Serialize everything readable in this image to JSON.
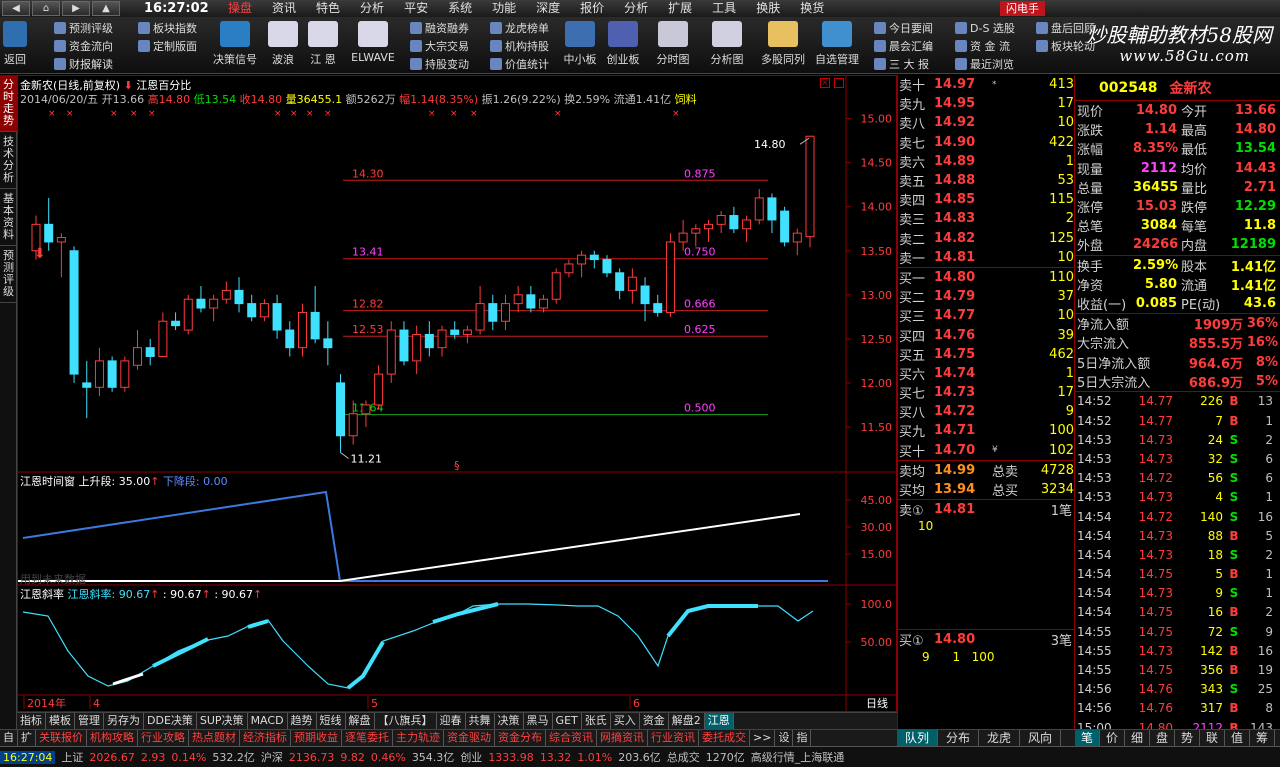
{
  "menubar": {
    "time": "16:27:02",
    "items": [
      "操盘",
      "资讯",
      "特色",
      "分析",
      "平安",
      "系统",
      "功能",
      "深度",
      "报价",
      "分析",
      "扩展",
      "工具",
      "换肤",
      "换货"
    ],
    "active_index": 0,
    "flash_label": "闪电手"
  },
  "toolbar": {
    "back": "返回",
    "small_col1": [
      "预测评级",
      "资金流向",
      "财报解读"
    ],
    "small_col2": [
      "板块指数",
      "定制版面"
    ],
    "big": [
      "决策信号",
      "波浪",
      "江 恩",
      "ELWAVE"
    ],
    "small_col3": [
      "融资融券",
      "大宗交易",
      "持股变动"
    ],
    "small_col4": [
      "龙虎榜单",
      "机构持股",
      "价值统计"
    ],
    "big2": [
      "中小板",
      "创业板",
      "分时图",
      "分析图",
      "多股同列",
      "自选管理"
    ],
    "small_col5": [
      "今日要闻",
      "晨会汇编",
      "三 大 报"
    ],
    "small_col6": [
      "D-S 选股",
      "资 金 流",
      "最近浏览"
    ],
    "small_col7": [
      "盘后回顾",
      "板块轮动"
    ],
    "watermark": "炒股輔助教材58股网",
    "watermark_url": "www.58Gu.com"
  },
  "vtabs": [
    "分时走势",
    "技术分析",
    "基本资料",
    "预测评级"
  ],
  "chart": {
    "title": "金新农(日线,前复权)",
    "indicator_name": "江恩百分比",
    "info": {
      "date": "2014/06/20/五",
      "open": "开13.66",
      "high": "高14.80",
      "low": "低13.54",
      "close": "收14.80",
      "volume": "量36455.1",
      "amount": "额5262万",
      "change": "幅1.14(8.35%)",
      "swing": "振1.26(9.22%)",
      "turnover": "换2.59%",
      "float": "流通1.41亿",
      "sector": "饲料"
    },
    "price_axis": [
      "15.00",
      "14.50",
      "14.00",
      "13.50",
      "13.00",
      "12.50",
      "12.00",
      "11.50"
    ],
    "levels": [
      {
        "price": "14.30",
        "ratio": "0.875"
      },
      {
        "price": "13.41",
        "ratio": "0.750"
      },
      {
        "price": "12.82",
        "ratio": "0.666"
      },
      {
        "price": "12.53",
        "ratio": "0.625"
      },
      {
        "price": "11.64",
        "ratio": "0.500"
      }
    ],
    "high_label": "14.80",
    "low_label": "11.21",
    "sub1_title": "江恩时间窗",
    "sub1_up": "上升段: 35.00",
    "sub1_down": "下降段: 0.00",
    "sub1_axis": [
      "45.00",
      "30.00",
      "15.00"
    ],
    "sub1_note": "用到未来数据",
    "sub2_title": "江恩斜率",
    "sub2_name": "江恩斜率: 90.67",
    "sub2_v2": ": 90.67",
    "sub2_v3": ": 90.67",
    "sub2_axis": [
      "100.0",
      "50.00"
    ],
    "x_labels": [
      "2014年",
      "4",
      "5",
      "6"
    ],
    "period": "日线"
  },
  "chart_data": {
    "type": "candlestick",
    "title": "金新农(日线,前复权)",
    "ylim": [
      11.0,
      15.2
    ],
    "candles": [
      [
        13.5,
        13.9,
        13.4,
        13.8
      ],
      [
        13.8,
        14.1,
        13.5,
        13.6
      ],
      [
        13.6,
        13.7,
        13.2,
        13.65
      ],
      [
        13.5,
        13.55,
        12.0,
        12.1
      ],
      [
        12.0,
        12.25,
        11.6,
        11.95
      ],
      [
        11.95,
        12.4,
        11.85,
        12.25
      ],
      [
        12.25,
        12.3,
        11.9,
        11.95
      ],
      [
        11.95,
        12.3,
        11.9,
        12.25
      ],
      [
        12.2,
        12.6,
        12.15,
        12.4
      ],
      [
        12.4,
        12.5,
        12.2,
        12.3
      ],
      [
        12.3,
        12.8,
        12.3,
        12.7
      ],
      [
        12.7,
        12.8,
        12.6,
        12.65
      ],
      [
        12.6,
        13.0,
        12.55,
        12.95
      ],
      [
        12.95,
        13.1,
        12.8,
        12.85
      ],
      [
        12.85,
        13.0,
        12.7,
        12.95
      ],
      [
        12.95,
        13.15,
        12.9,
        13.05
      ],
      [
        13.05,
        13.2,
        12.8,
        12.9
      ],
      [
        12.9,
        13.0,
        12.7,
        12.75
      ],
      [
        12.75,
        12.95,
        12.7,
        12.9
      ],
      [
        12.9,
        13.0,
        12.5,
        12.6
      ],
      [
        12.6,
        12.7,
        12.3,
        12.4
      ],
      [
        12.4,
        12.9,
        12.3,
        12.8
      ],
      [
        12.8,
        13.1,
        12.45,
        12.5
      ],
      [
        12.5,
        12.7,
        12.2,
        12.4
      ],
      [
        12.0,
        12.1,
        11.21,
        11.4
      ],
      [
        11.4,
        11.8,
        11.3,
        11.65
      ],
      [
        11.65,
        11.8,
        11.5,
        11.75
      ],
      [
        11.75,
        12.2,
        11.7,
        12.1
      ],
      [
        12.1,
        12.7,
        12.0,
        12.6
      ],
      [
        12.6,
        12.7,
        12.2,
        12.25
      ],
      [
        12.25,
        12.65,
        12.1,
        12.55
      ],
      [
        12.55,
        12.7,
        12.3,
        12.4
      ],
      [
        12.4,
        12.65,
        12.3,
        12.6
      ],
      [
        12.6,
        12.7,
        12.5,
        12.55
      ],
      [
        12.55,
        12.65,
        12.45,
        12.6
      ],
      [
        12.6,
        13.1,
        12.55,
        12.9
      ],
      [
        12.9,
        13.0,
        12.6,
        12.7
      ],
      [
        12.7,
        13.0,
        12.6,
        12.9
      ],
      [
        12.9,
        13.1,
        12.8,
        13.0
      ],
      [
        13.0,
        13.1,
        12.8,
        12.85
      ],
      [
        12.85,
        13.0,
        12.8,
        12.95
      ],
      [
        12.95,
        13.3,
        12.9,
        13.25
      ],
      [
        13.25,
        13.4,
        13.2,
        13.35
      ],
      [
        13.35,
        13.5,
        13.2,
        13.45
      ],
      [
        13.45,
        13.5,
        13.3,
        13.4
      ],
      [
        13.4,
        13.45,
        13.2,
        13.25
      ],
      [
        13.25,
        13.3,
        12.95,
        13.05
      ],
      [
        13.05,
        13.3,
        12.9,
        13.2
      ],
      [
        13.1,
        13.2,
        12.7,
        12.9
      ],
      [
        12.9,
        13.0,
        12.75,
        12.8
      ],
      [
        12.8,
        13.7,
        12.75,
        13.6
      ],
      [
        13.6,
        13.85,
        13.5,
        13.7
      ],
      [
        13.7,
        13.8,
        13.55,
        13.75
      ],
      [
        13.75,
        13.85,
        13.6,
        13.8
      ],
      [
        13.8,
        13.95,
        13.7,
        13.9
      ],
      [
        13.9,
        14.0,
        13.7,
        13.75
      ],
      [
        13.75,
        13.9,
        13.6,
        13.85
      ],
      [
        13.85,
        14.2,
        13.8,
        14.1
      ],
      [
        14.1,
        14.15,
        13.7,
        13.85
      ],
      [
        13.95,
        14.0,
        13.55,
        13.6
      ],
      [
        13.6,
        13.75,
        13.45,
        13.7
      ],
      [
        13.66,
        14.8,
        13.54,
        14.8
      ]
    ],
    "gann_levels": [
      14.3,
      13.41,
      12.82,
      12.53,
      11.64
    ]
  },
  "orderbook": {
    "sell": [
      {
        "label": "卖十",
        "price": "14.97",
        "mark": "*",
        "vol": "413"
      },
      {
        "label": "卖九",
        "price": "14.95",
        "mark": "",
        "vol": "17"
      },
      {
        "label": "卖八",
        "price": "14.92",
        "mark": "",
        "vol": "10"
      },
      {
        "label": "卖七",
        "price": "14.90",
        "mark": "",
        "vol": "422"
      },
      {
        "label": "卖六",
        "price": "14.89",
        "mark": "",
        "vol": "1"
      },
      {
        "label": "卖五",
        "price": "14.88",
        "mark": "",
        "vol": "53"
      },
      {
        "label": "卖四",
        "price": "14.85",
        "mark": "",
        "vol": "115"
      },
      {
        "label": "卖三",
        "price": "14.83",
        "mark": "",
        "vol": "2"
      },
      {
        "label": "卖二",
        "price": "14.82",
        "mark": "",
        "vol": "125"
      },
      {
        "label": "卖一",
        "price": "14.81",
        "mark": "",
        "vol": "10"
      }
    ],
    "buy": [
      {
        "label": "买一",
        "price": "14.80",
        "mark": "",
        "vol": "110"
      },
      {
        "label": "买二",
        "price": "14.79",
        "mark": "",
        "vol": "37"
      },
      {
        "label": "买三",
        "price": "14.77",
        "mark": "",
        "vol": "10"
      },
      {
        "label": "买四",
        "price": "14.76",
        "mark": "",
        "vol": "39"
      },
      {
        "label": "买五",
        "price": "14.75",
        "mark": "",
        "vol": "462"
      },
      {
        "label": "买六",
        "price": "14.74",
        "mark": "",
        "vol": "1"
      },
      {
        "label": "买七",
        "price": "14.73",
        "mark": "",
        "vol": "17"
      },
      {
        "label": "买八",
        "price": "14.72",
        "mark": "",
        "vol": "9"
      },
      {
        "label": "买九",
        "price": "14.71",
        "mark": "",
        "vol": "100"
      },
      {
        "label": "买十",
        "price": "14.70",
        "mark": "¥",
        "vol": "102"
      }
    ],
    "avg_sell_label": "卖均",
    "avg_sell": "14.99",
    "total_sell_label": "总卖",
    "total_sell": "4728",
    "avg_buy_label": "买均",
    "avg_buy": "13.94",
    "total_buy_label": "总买",
    "total_buy": "3234",
    "sell1_label": "卖①",
    "sell1_price": "14.81",
    "sell1_count": "1笔",
    "sell1_detail": "10",
    "buy1_label": "买①",
    "buy1_price": "14.80",
    "buy1_count": "3笔",
    "buy1_detail": "9      1   100"
  },
  "quote": {
    "code": "002548",
    "name": "金新农",
    "rows": [
      {
        "l1": "现价",
        "v1": "14.80",
        "c1": "#ff3c3c",
        "l2": "今开",
        "v2": "13.66",
        "c2": "#ff3c3c"
      },
      {
        "l1": "涨跌",
        "v1": "1.14",
        "c1": "#ff3c3c",
        "l2": "最高",
        "v2": "14.80",
        "c2": "#ff3c3c"
      },
      {
        "l1": "涨幅",
        "v1": "8.35%",
        "c1": "#ff3c3c",
        "l2": "最低",
        "v2": "13.54",
        "c2": "#00e000"
      },
      {
        "l1": "现量",
        "v1": "2112",
        "c1": "#ff40ff",
        "l2": "均价",
        "v2": "14.43",
        "c2": "#ff3c3c"
      },
      {
        "l1": "总量",
        "v1": "36455",
        "c1": "#ffff00",
        "l2": "量比",
        "v2": "2.71",
        "c2": "#ff3c3c"
      },
      {
        "l1": "涨停",
        "v1": "15.03",
        "c1": "#ff3c3c",
        "l2": "跌停",
        "v2": "12.29",
        "c2": "#00e000"
      },
      {
        "l1": "总笔",
        "v1": "3084",
        "c1": "#ffff00",
        "l2": "每笔",
        "v2": "11.8",
        "c2": "#ffff00"
      },
      {
        "l1": "外盘",
        "v1": "24266",
        "c1": "#ff3c3c",
        "l2": "内盘",
        "v2": "12189",
        "c2": "#00e000"
      },
      {
        "l1": "换手",
        "v1": "2.59%",
        "c1": "#ffff00",
        "l2": "股本",
        "v2": "1.41亿",
        "c2": "#ffff00"
      },
      {
        "l1": "净资",
        "v1": "5.80",
        "c1": "#ffff00",
        "l2": "流通",
        "v2": "1.41亿",
        "c2": "#ffff00"
      },
      {
        "l1": "收益(一)",
        "v1": "0.085",
        "c1": "#ffff00",
        "l2": "PE(动)",
        "v2": "43.6",
        "c2": "#ffff00"
      }
    ],
    "flows": [
      {
        "l": "净流入额",
        "v": "1909万",
        "p": "36%"
      },
      {
        "l": "大宗流入",
        "v": "855.5万",
        "p": "16%"
      },
      {
        "l": "5日净流入额",
        "v": "964.6万",
        "p": "8%"
      },
      {
        "l": "5日大宗流入",
        "v": "686.9万",
        "p": "5%"
      }
    ],
    "ticks": [
      {
        "t": "14:52",
        "p": "14.77",
        "v": "226",
        "bs": "B",
        "n": "13"
      },
      {
        "t": "14:52",
        "p": "14.77",
        "v": "7",
        "bs": "B",
        "n": "1"
      },
      {
        "t": "14:53",
        "p": "14.73",
        "v": "24",
        "bs": "S",
        "n": "2"
      },
      {
        "t": "14:53",
        "p": "14.73",
        "v": "32",
        "bs": "S",
        "n": "6"
      },
      {
        "t": "14:53",
        "p": "14.72",
        "v": "56",
        "bs": "S",
        "n": "6"
      },
      {
        "t": "14:53",
        "p": "14.73",
        "v": "4",
        "bs": "S",
        "n": "1"
      },
      {
        "t": "14:54",
        "p": "14.72",
        "v": "140",
        "bs": "S",
        "n": "16"
      },
      {
        "t": "14:54",
        "p": "14.73",
        "v": "88",
        "bs": "B",
        "n": "5"
      },
      {
        "t": "14:54",
        "p": "14.73",
        "v": "18",
        "bs": "S",
        "n": "2"
      },
      {
        "t": "14:54",
        "p": "14.75",
        "v": "5",
        "bs": "B",
        "n": "1"
      },
      {
        "t": "14:54",
        "p": "14.73",
        "v": "9",
        "bs": "S",
        "n": "1"
      },
      {
        "t": "14:54",
        "p": "14.75",
        "v": "16",
        "bs": "B",
        "n": "2"
      },
      {
        "t": "14:55",
        "p": "14.75",
        "v": "72",
        "bs": "S",
        "n": "9"
      },
      {
        "t": "14:55",
        "p": "14.73",
        "v": "142",
        "bs": "B",
        "n": "16"
      },
      {
        "t": "14:55",
        "p": "14.75",
        "v": "356",
        "bs": "B",
        "n": "19"
      },
      {
        "t": "14:56",
        "p": "14.76",
        "v": "343",
        "bs": "S",
        "n": "25"
      },
      {
        "t": "14:56",
        "p": "14.76",
        "v": "317",
        "bs": "B",
        "n": "8"
      },
      {
        "t": "15:00",
        "p": "14.80",
        "v": "2112",
        "bs": "B",
        "n": "143"
      }
    ]
  },
  "chart_tabs": [
    "指标",
    "模板",
    "管理",
    "另存为",
    "DDE决策",
    "SUP决策",
    "MACD",
    "趋势",
    "短线",
    "解盘",
    "【八旗兵】",
    "迎春",
    "共舞",
    "决策",
    "黑马",
    "GET",
    "张氏",
    "买入",
    "资金",
    "解盘2",
    "江恩"
  ],
  "right_tabs1": [
    "队列",
    "分布",
    "龙虎",
    "风向"
  ],
  "right_tabs2": [
    "笔",
    "价",
    "细",
    "盘",
    "势",
    "联",
    "值",
    "筹"
  ],
  "bottom_tabs": [
    "自",
    "扩",
    "关联报价",
    "机构攻略",
    "行业攻略",
    "热点题材",
    "经济指标",
    "预期收益",
    "逐笔委托",
    "主力轨迹",
    "资金驱动",
    "资金分布",
    "综合资讯",
    "网摘资讯",
    "行业资讯",
    "委托成交",
    ">>",
    "设",
    "指"
  ],
  "status": {
    "time": "16:27:04",
    "sh_label": "上证",
    "sh_val": "2026.67",
    "sh_chg": "2.93",
    "sh_pct": "0.14%",
    "sh_amt": "532.2亿",
    "sz_label": "沪深",
    "sz_val": "2136.73",
    "sz_chg": "9.82",
    "sz_pct": "0.46%",
    "sz_amt": "354.3亿",
    "cy_label": "创业",
    "cy_val": "1333.98",
    "cy_chg": "13.32",
    "cy_pct": "1.01%",
    "cy_amt": "203.6亿",
    "total_label": "总成交",
    "total_val": "1270亿",
    "conn": "高级行情_上海联通"
  }
}
